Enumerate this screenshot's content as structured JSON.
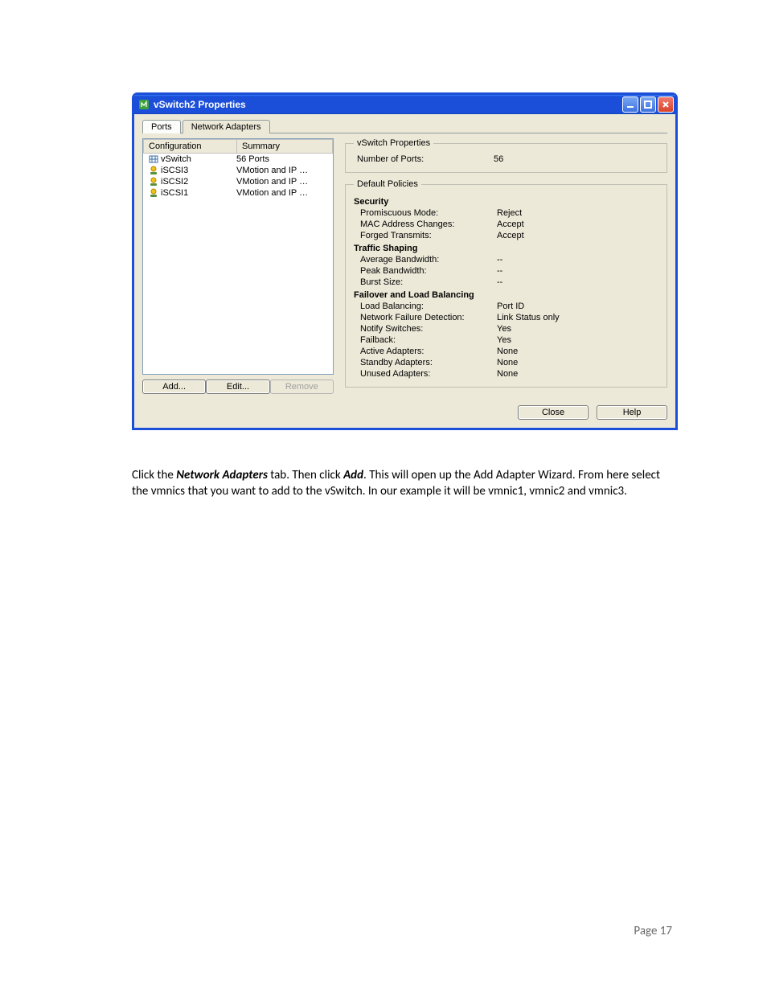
{
  "window": {
    "title": "vSwitch2 Properties"
  },
  "tabs": {
    "ports": "Ports",
    "network_adapters": "Network Adapters"
  },
  "config": {
    "headers": {
      "configuration": "Configuration",
      "summary": "Summary"
    },
    "rows": [
      {
        "name": "vSwitch",
        "summary": "56 Ports",
        "icon": "vswitch"
      },
      {
        "name": "iSCSI3",
        "summary": "VMotion and IP …",
        "icon": "portgroup"
      },
      {
        "name": "iSCSI2",
        "summary": "VMotion and IP …",
        "icon": "portgroup"
      },
      {
        "name": "iSCSI1",
        "summary": "VMotion and IP …",
        "icon": "portgroup"
      }
    ]
  },
  "buttons": {
    "add": "Add...",
    "edit": "Edit...",
    "remove": "Remove",
    "close": "Close",
    "help": "Help"
  },
  "details": {
    "vswitch_properties": {
      "legend": "vSwitch Properties",
      "number_of_ports": {
        "label": "Number of Ports:",
        "value": "56"
      }
    },
    "default_policies": {
      "legend": "Default Policies",
      "security": {
        "header": "Security",
        "promiscuous_mode": {
          "label": "Promiscuous Mode:",
          "value": "Reject"
        },
        "mac_address_changes": {
          "label": "MAC Address Changes:",
          "value": "Accept"
        },
        "forged_transmits": {
          "label": "Forged Transmits:",
          "value": "Accept"
        }
      },
      "traffic_shaping": {
        "header": "Traffic Shaping",
        "average_bandwidth": {
          "label": "Average Bandwidth:",
          "value": "--"
        },
        "peak_bandwidth": {
          "label": "Peak Bandwidth:",
          "value": "--"
        },
        "burst_size": {
          "label": "Burst Size:",
          "value": "--"
        }
      },
      "failover": {
        "header": "Failover and Load Balancing",
        "load_balancing": {
          "label": "Load Balancing:",
          "value": "Port ID"
        },
        "network_failure_detection": {
          "label": "Network Failure Detection:",
          "value": "Link Status only"
        },
        "notify_switches": {
          "label": "Notify Switches:",
          "value": "Yes"
        },
        "failback": {
          "label": "Failback:",
          "value": "Yes"
        },
        "active_adapters": {
          "label": "Active Adapters:",
          "value": "None"
        },
        "standby_adapters": {
          "label": "Standby Adapters:",
          "value": "None"
        },
        "unused_adapters": {
          "label": "Unused Adapters:",
          "value": "None"
        }
      }
    }
  },
  "doc": {
    "p1a": "Click the ",
    "p1b": "Network Adapters",
    "p1c": " tab. Then click ",
    "p1d": "Add",
    "p1e": ". This will open up the Add Adapter Wizard.  From here select the vmnics that you want to add to the vSwitch. In our example it will be vmnic1, vmnic2 and vmnic3."
  },
  "page_number": "Page 17"
}
